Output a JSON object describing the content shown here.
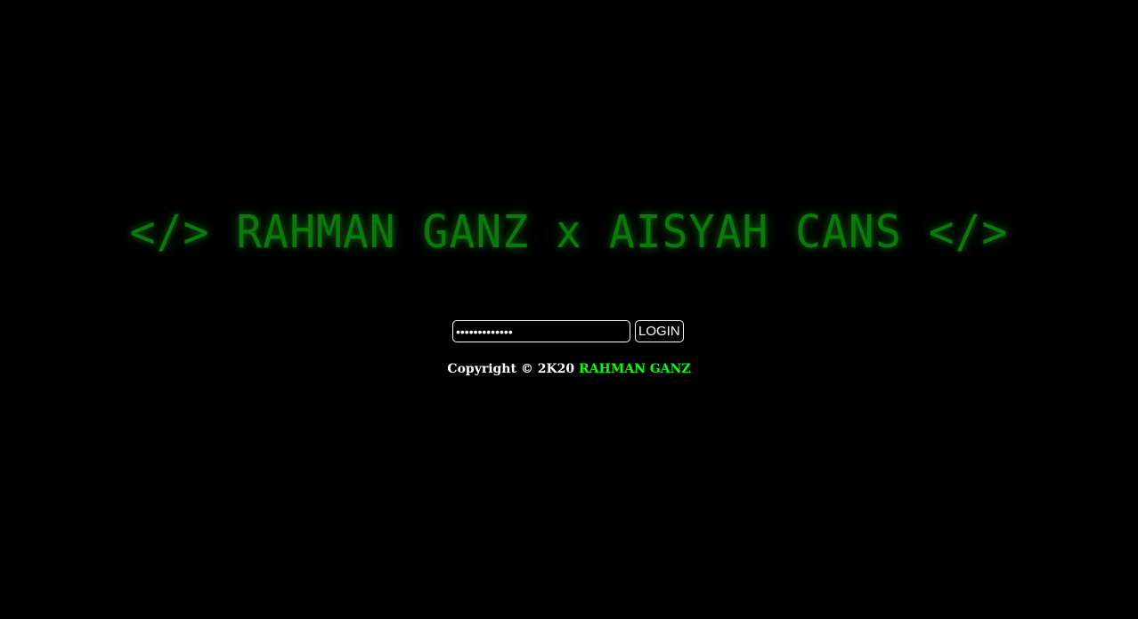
{
  "header": {
    "title": "</> RAHMAN GANZ x AISYAH CANS </>"
  },
  "login": {
    "password_value": "•••••••••••••",
    "button_label": "LOGIN"
  },
  "footer": {
    "copyright_prefix": "Copyright © 2K20 ",
    "brand": "RAHMAN GANZ"
  },
  "colors": {
    "background": "#000000",
    "title_green": "#0a7a0a",
    "brand_green": "#00ff00",
    "border_white": "#ffffff"
  }
}
